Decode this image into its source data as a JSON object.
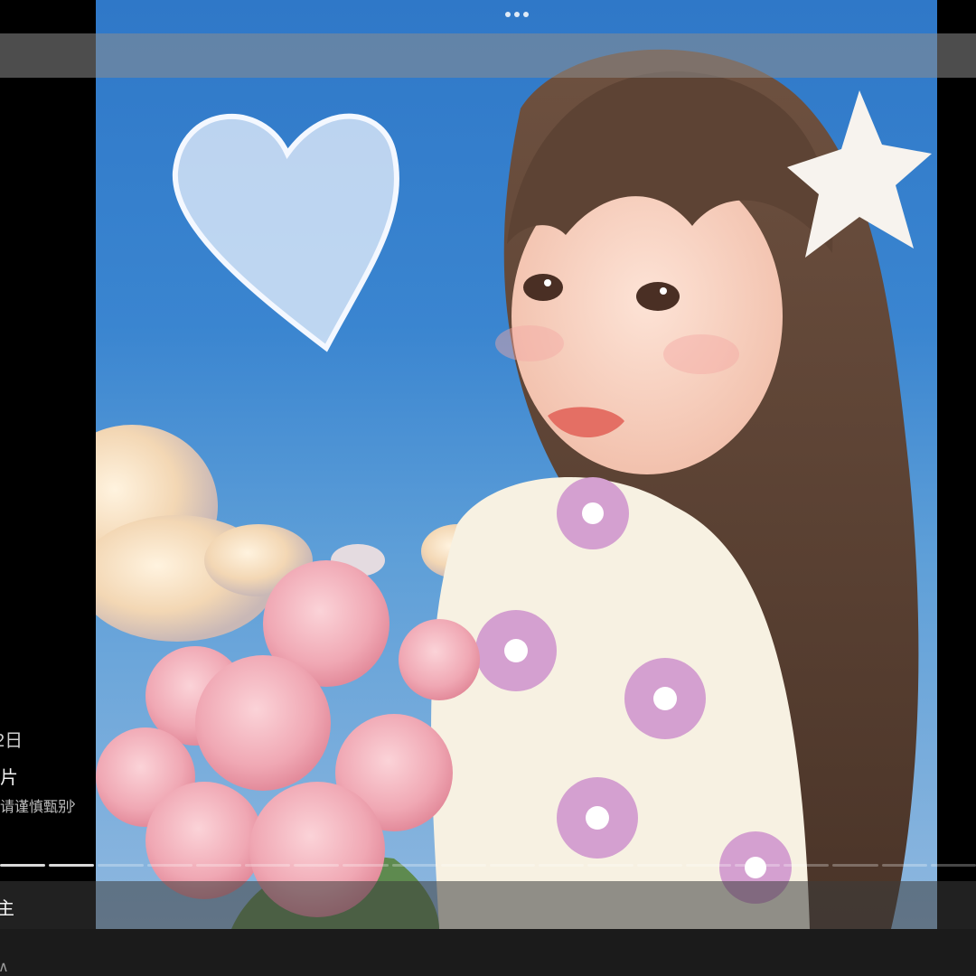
{
  "viewer": {
    "more_icon": "more-dots-icon",
    "artwork_alt": "illustration"
  },
  "left_panel": {
    "date": "2日",
    "type": "片",
    "notice": "请谨慎甄别",
    "notice_chevron": "›"
  },
  "progress": {
    "total_segments": 20,
    "current_segment": 2
  },
  "caption": {
    "text": "主"
  },
  "bottom_bar": {
    "glyph": "∧"
  },
  "colors": {
    "background": "#000000",
    "sky": "#3a85d0",
    "overlay": "#8c8c8c"
  }
}
